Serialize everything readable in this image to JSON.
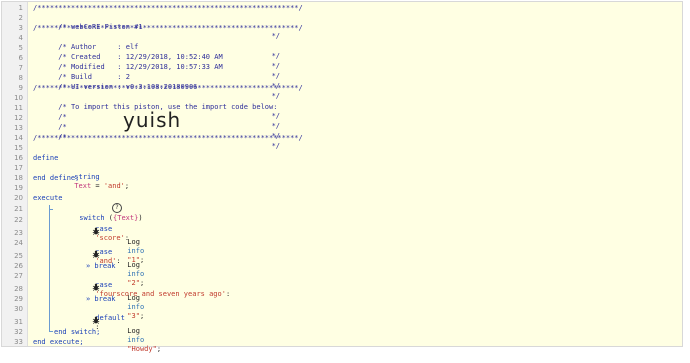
{
  "line_numbers": [
    "1",
    "2",
    "3",
    "4",
    "5",
    "6",
    "7",
    "8",
    "9",
    "10",
    "11",
    "12",
    "13",
    "14",
    "15",
    "16",
    "17",
    "18",
    "19",
    "20",
    "21",
    "22",
    "23",
    "24",
    "25",
    "26",
    "27",
    "28",
    "29",
    "30",
    "31",
    "32",
    "33"
  ],
  "header": {
    "stars_top": "/**************************************************************/",
    "title": "/* webCoRE Piston #1",
    "stars_2": "/**************************************************************/",
    "author": "/* Author     : elf",
    "created": "/* Created    : 12/29/2018, 10:52:40 AM",
    "modified": "/* Modified   : 12/29/2018, 10:57:33 AM",
    "build": "/* Build      : 2",
    "ui_version": "/* UI version : v0.3.108.20180906",
    "stars_3": "/**************************************************************/",
    "import_text": "/* To import this piston, use the import code below:",
    "blank_a": "/*",
    "blank_b": "/*",
    "blank_c": "/*",
    "stars_4": "/**************************************************************/",
    "end_mark": "*/",
    "import_code": "yuish"
  },
  "code": {
    "define": "define",
    "string_kw": "string",
    "var_text": "Text",
    "eq": " = ",
    "define_value": "'and'",
    "semicolon": ";",
    "end_define": "end define;",
    "execute": "execute",
    "switch_kw": "switch",
    "switch_open": " (",
    "switch_var": "{Text}",
    "switch_close": ")",
    "case1_kw": "case",
    "case1_val": "'score'",
    "colon": ":",
    "log_kw": "Log",
    "info_kw": "info",
    "log1_val": "\"1\"",
    "case2_val": "'and'",
    "log2_val": "\"2\"",
    "break_label": "» break",
    "case3_val": "'fourscore and seven years ago'",
    "log3_val": "\"3\"",
    "default_kw": "default",
    "log4_val": "\"Howdy\"",
    "end_switch": "end switch;",
    "end_execute": "end execute;",
    "help_icon": "?"
  }
}
